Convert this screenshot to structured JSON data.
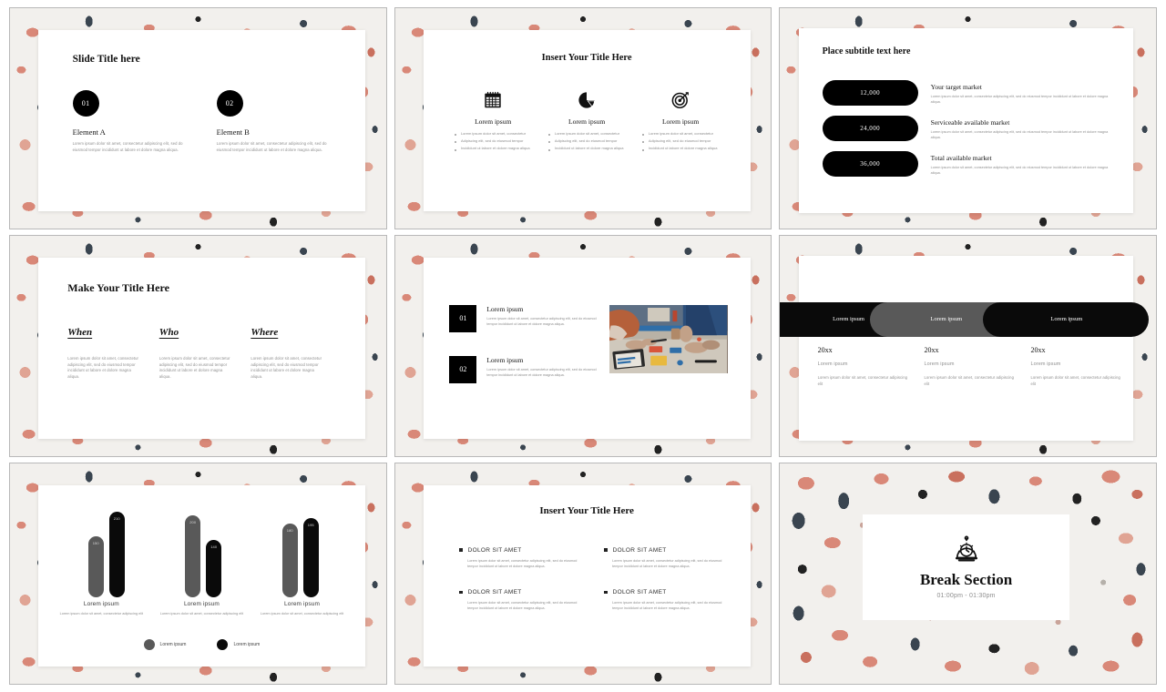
{
  "deck": {
    "theme": {
      "accent_coral": "#d98878",
      "accent_slate": "#3a4550",
      "bg_offwhite": "#f2f0ed",
      "ink": "#0a0a0a",
      "gray": "#595959"
    },
    "lorem_long": "Lorem ipsum dolor sit amet, consectetur adipiscing elit, sed do eiusmod tempor incididunt ut labore et dolore magna aliqua.",
    "lorem_mid": "Lorem ipsum dolor sit amet, consectetur adipiscing elit, sed do eiusmod tempor incididunt ut labore et dolore magna aliqua.",
    "lorem_short": "Lorem ipsum dolor sit amet, consectetur adipiscing elit"
  },
  "slides": [
    {
      "id": "slide-1-two-elements",
      "title": "Slide Title here",
      "items": [
        {
          "number": "01",
          "heading": "Element A",
          "body": "Lorem ipsum dolor sit amet, consectetur adipiscing elit, sed do eiusmod tempor incididunt ut labore et dolore magna aliqua."
        },
        {
          "number": "02",
          "heading": "Element B",
          "body": "Lorem ipsum dolor sit amet, consectetur adipiscing elit, sed do eiusmod tempor incididunt ut labore et dolore magna aliqua."
        }
      ]
    },
    {
      "id": "slide-2-three-icons",
      "title": "Insert Your Title Here",
      "columns": [
        {
          "icon": "calendar-icon",
          "heading": "Lorem ipsum",
          "bullets": [
            "Lorem ipsum dolor sit amet, consectetur",
            "Adipiscing elit, sed do eiusmod tempor",
            "Incididunt ut labore et dolore magna aliqua"
          ]
        },
        {
          "icon": "pie-chart-icon",
          "heading": "Lorem ipsum",
          "bullets": [
            "Lorem ipsum dolor sit amet, consectetur",
            "Adipiscing elit, sed do eiusmod tempor",
            "Incididunt ut labore et dolore magna aliqua"
          ]
        },
        {
          "icon": "target-icon",
          "heading": "Lorem ipsum",
          "bullets": [
            "Lorem ipsum dolor sit amet, consectetur",
            "Adipiscing elit, sed do eiusmod tempor",
            "Incididunt ut labore et dolore magna aliqua"
          ]
        }
      ]
    },
    {
      "id": "slide-3-market-sizing",
      "title": "Place subtitle text here",
      "rows": [
        {
          "value": "12,000",
          "heading": "Your target market",
          "body": "Lorem ipsum dolor sit amet, consectetur adipiscing elit, sed do eiusmod tempor incididunt ut labore et dolore magna aliqua."
        },
        {
          "value": "24,000",
          "heading": "Serviceable available market",
          "body": "Lorem ipsum dolor sit amet, consectetur adipiscing elit, sed do eiusmod tempor incididunt ut labore et dolore magna aliqua."
        },
        {
          "value": "36,000",
          "heading": "Total available market",
          "body": "Lorem ipsum dolor sit amet, consectetur adipiscing elit, sed do eiusmod tempor incididunt ut labore et dolore magna aliqua."
        }
      ]
    },
    {
      "id": "slide-4-when-who-where",
      "title": "Make Your Title Here",
      "columns": [
        {
          "heading": "When",
          "body": "Lorem ipsum dolor sit amet, consectetur adipiscing elit, sed do eiusmod tempor incididunt ut labore et dolore magna aliqua."
        },
        {
          "heading": "Who",
          "body": "Lorem ipsum dolor sit amet, consectetur adipiscing elit, sed do eiusmod tempor incididunt ut labore et dolore magna aliqua."
        },
        {
          "heading": "Where",
          "body": "Lorem ipsum dolor sit amet, consectetur adipiscing elit, sed do eiusmod tempor incididunt ut labore et dolore magna aliqua."
        }
      ]
    },
    {
      "id": "slide-5-numbered-with-photo",
      "items": [
        {
          "number": "01",
          "heading": "Lorem ipsum",
          "body": "Lorem ipsum dolor sit amet, consectetur adipiscing elit, sed do eiusmod tempor incididunt ut labore et dolore magna aliqua."
        },
        {
          "number": "02",
          "heading": "Lorem ipsum",
          "body": "Lorem ipsum dolor sit amet, consectetur adipiscing elit, sed do eiusmod tempor incididunt ut labore et dolore magna aliqua."
        }
      ],
      "photo_caption": "team meeting around table with documents"
    },
    {
      "id": "slide-6-timeline",
      "segments": [
        {
          "label": "Lorem ipsum",
          "color": "#0a0a0a"
        },
        {
          "label": "Lorem ipsum",
          "color": "#595959"
        },
        {
          "label": "Lorem ipsum",
          "color": "#0a0a0a"
        }
      ],
      "columns": [
        {
          "year": "20xx",
          "subheading": "Lorem ipsum",
          "body": "Lorem ipsum dolor sit amet, consectetur adipiscing elit"
        },
        {
          "year": "20xx",
          "subheading": "Lorem ipsum",
          "body": "Lorem ipsum dolor sit amet, consectetur adipiscing elit"
        },
        {
          "year": "20xx",
          "subheading": "Lorem ipsum",
          "body": "Lorem ipsum dolor sit amet, consectetur adipiscing elit"
        }
      ]
    },
    {
      "id": "slide-7-bar-chart",
      "group_labels": [
        {
          "heading": "Lorem ipsum",
          "body": "Lorem ipsum dolor sit amet, consectetur adipiscing elit"
        },
        {
          "heading": "Lorem ipsum",
          "body": "Lorem ipsum dolor sit amet, consectetur adipiscing elit"
        },
        {
          "heading": "Lorem ipsum",
          "body": "Lorem ipsum dolor sit amet, consectetur adipiscing elit"
        }
      ],
      "legend": [
        {
          "label": "Lorem ipsum",
          "color": "#595959"
        },
        {
          "label": "Lorem ipsum",
          "color": "#0a0a0a"
        }
      ]
    },
    {
      "id": "slide-8-four-bullets",
      "title": "Insert Your Title Here",
      "items": [
        {
          "heading": "DOLOR SIT AMET",
          "body": "Lorem ipsum dolor sit amet, consectetur adipiscing elit, sed do eiusmod tempor incididunt ut labore et dolore magna aliqua."
        },
        {
          "heading": "DOLOR SIT AMET",
          "body": "Lorem ipsum dolor sit amet, consectetur adipiscing elit, sed do eiusmod tempor incididunt ut labore et dolore magna aliqua."
        },
        {
          "heading": "DOLOR SIT AMET",
          "body": "Lorem ipsum dolor sit amet, consectetur adipiscing elit, sed do eiusmod tempor incididunt ut labore et dolore magna aliqua."
        },
        {
          "heading": "DOLOR SIT AMET",
          "body": "Lorem ipsum dolor sit amet, consectetur adipiscing elit, sed do eiusmod tempor incididunt ut labore et dolore magna aliqua."
        }
      ]
    },
    {
      "id": "slide-9-break-section",
      "icon": "table-clock-icon",
      "title": "Break Section",
      "time_range": "01:00pm - 01:30pm"
    }
  ],
  "chart_data": {
    "type": "bar",
    "title": "",
    "categories": [
      "Lorem ipsum",
      "Lorem ipsum",
      "Lorem ipsum"
    ],
    "series": [
      {
        "name": "Lorem ipsum",
        "color": "#595959",
        "values": [
          150,
          200,
          180
        ]
      },
      {
        "name": "Lorem ipsum",
        "color": "#0a0a0a",
        "values": [
          210,
          140,
          195
        ]
      }
    ],
    "ylim": [
      0,
      230
    ],
    "xlabel": "",
    "ylabel": "",
    "grid": false,
    "legend_position": "bottom",
    "data_labels": true
  }
}
